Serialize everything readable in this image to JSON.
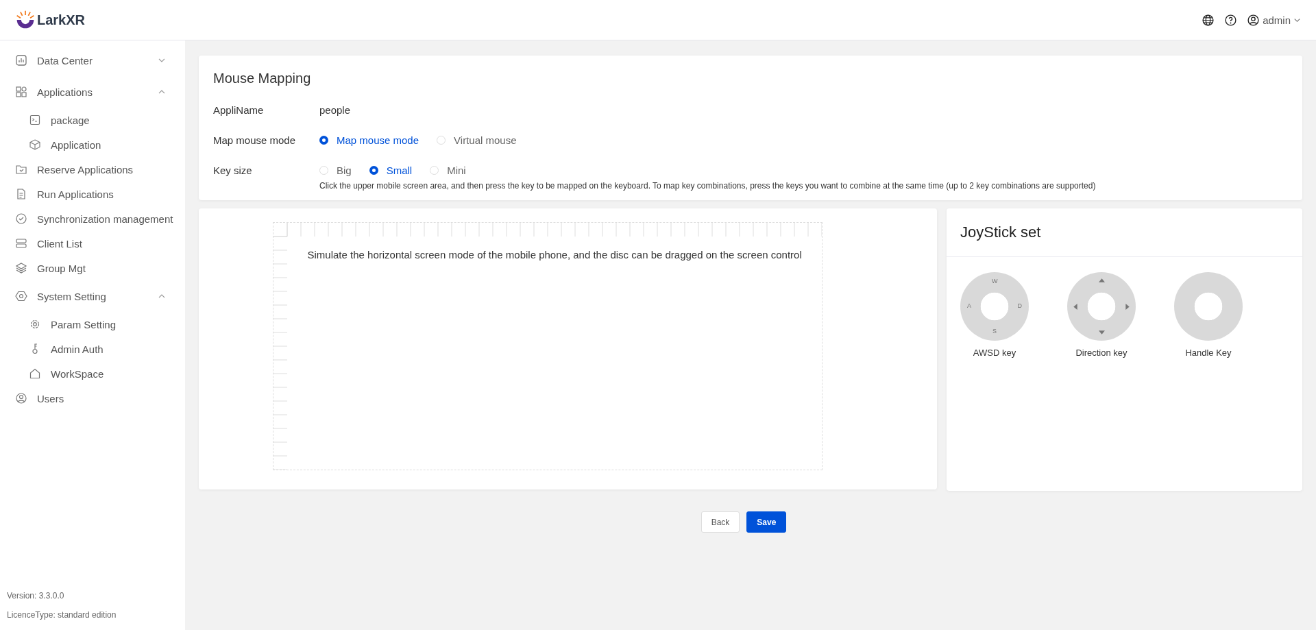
{
  "brand": {
    "name": "LarkXR"
  },
  "header": {
    "user": "admin"
  },
  "sidebar": {
    "items": [
      {
        "label": "Data Center",
        "expanded": false
      },
      {
        "label": "Applications",
        "expanded": true,
        "children": [
          {
            "label": "package"
          },
          {
            "label": "Application"
          }
        ]
      },
      {
        "label": "Reserve Applications"
      },
      {
        "label": "Run Applications"
      },
      {
        "label": "Synchronization management"
      },
      {
        "label": "Client List"
      },
      {
        "label": "Group Mgt"
      },
      {
        "label": "System Setting",
        "expanded": true,
        "children": [
          {
            "label": "Param Setting"
          },
          {
            "label": "Admin Auth"
          },
          {
            "label": "WorkSpace"
          }
        ]
      },
      {
        "label": "Users"
      }
    ],
    "footer": [
      "Version: 3.3.0.0",
      "LicenceType: standard edition"
    ]
  },
  "form": {
    "title": "Mouse Mapping",
    "appli_name": {
      "label": "AppliName",
      "value": "people"
    },
    "map_mouse_mode": {
      "label": "Map mouse mode",
      "options": [
        {
          "label": "Map mouse mode",
          "selected": true
        },
        {
          "label": "Virtual mouse",
          "selected": false
        }
      ]
    },
    "key_size": {
      "label": "Key size",
      "options": [
        {
          "label": "Big",
          "selected": false
        },
        {
          "label": "Small",
          "selected": true
        },
        {
          "label": "Mini",
          "selected": false
        }
      ]
    },
    "hint": "Click the upper mobile screen area, and then press the key to be mapped on the keyboard. To map key combinations, press the keys you want to combine at the same time (up to 2 key combinations are supported)"
  },
  "screen": {
    "hint": "Simulate the horizontal screen mode of the mobile phone, and the disc can be dragged on the screen control"
  },
  "joystick": {
    "title": "JoyStick set",
    "items": [
      {
        "kind": "awsd",
        "label": "AWSD key",
        "keys": {
          "up": "W",
          "left": "A",
          "right": "D",
          "down": "S"
        }
      },
      {
        "kind": "direction",
        "label": "Direction key"
      },
      {
        "kind": "handle",
        "label": "Handle Key"
      }
    ]
  },
  "buttons": [
    {
      "label": "Back",
      "primary": false
    },
    {
      "label": "Save",
      "primary": true
    }
  ]
}
